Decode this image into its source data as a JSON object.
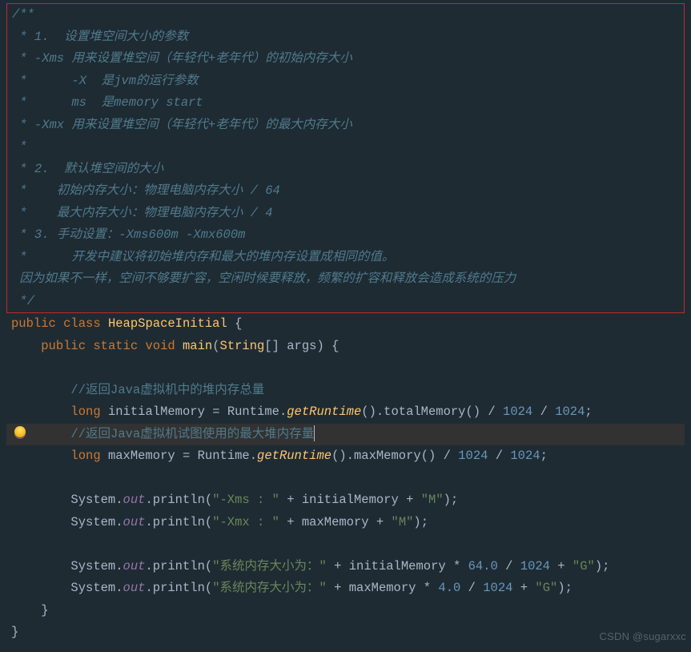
{
  "watermark": "CSDN @sugarxxc",
  "gutter": {
    "bulb_icon": "bulb-icon"
  },
  "doc": {
    "d0": "/**",
    "d1": " * 1.  设置堆空间大小的参数",
    "d2": " * -Xms 用来设置堆空间（年轻代+老年代）的初始内存大小",
    "d3": " *      -X  是jvm的运行参数",
    "d4": " *      ms  是memory start",
    "d5": " * -Xmx 用来设置堆空间（年轻代+老年代）的最大内存大小",
    "d6": " *",
    "d7": " * 2.  默认堆空间的大小",
    "d8": " *    初始内存大小：物理电脑内存大小 / 64",
    "d9": " *    最大内存大小：物理电脑内存大小 / 4",
    "d10": " * 3. 手动设置：-Xms600m -Xmx600m",
    "d11": " *      开发中建议将初始堆内存和最大的堆内存设置成相同的值。",
    "d12": " 因为如果不一样，空间不够要扩容，空闲时候要释放，频繁的扩容和释放会造成系统的压力",
    "d13": " */"
  },
  "code": {
    "public": "public",
    "class": "class",
    "static": "static",
    "void": "void",
    "long": "long",
    "HeapSpaceInitial": "HeapSpaceInitial",
    "main": "main",
    "String": "String",
    "args": "args",
    "cmt_total": "//返回Java虚拟机中的堆内存总量",
    "cmt_max": "//返回Java虚拟机试图使用的最大堆内存量",
    "initialMemory": "initialMemory",
    "maxMemory": "maxMemory",
    "Runtime": "Runtime",
    "getRuntime": "getRuntime",
    "totalMemory": "totalMemory",
    "maxMemoryCall": "maxMemory",
    "System": "System",
    "out": "out",
    "println": "println",
    "str_xms": "\"-Xms : \"",
    "str_xmx": "\"-Xmx : \"",
    "str_M": "\"M\"",
    "str_sys": "\"系统内存大小为：\"",
    "str_G": "\"G\"",
    "n1024": "1024",
    "n64": "64.0",
    "n4": "4.0"
  }
}
